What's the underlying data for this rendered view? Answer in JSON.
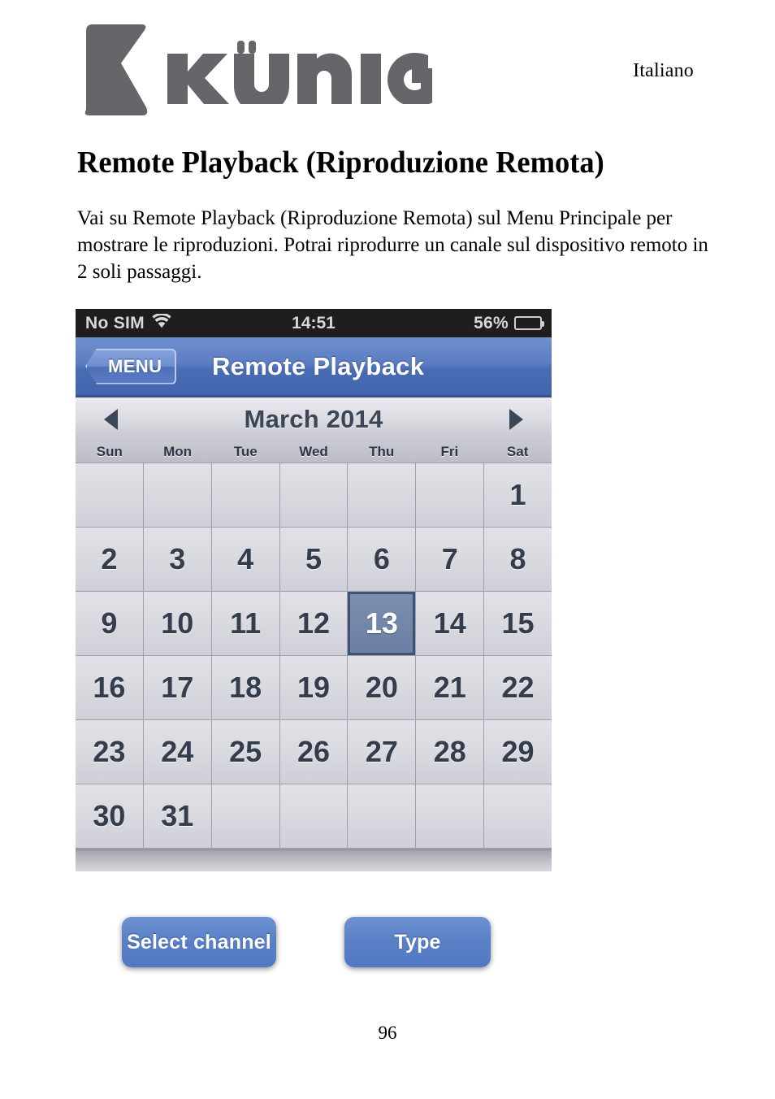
{
  "header": {
    "brand_name": "KÖNIG",
    "logo_icon": "konig-k-logo",
    "language": "Italiano"
  },
  "document": {
    "title": "Remote Playback (Riproduzione Remota)",
    "paragraph": "Vai su Remote Playback (Riproduzione Remota) sul Menu Principale per mostrare le riproduzioni. Potrai riprodurre un canale sul dispositivo remoto in 2 soli passaggi.",
    "page_number": "96"
  },
  "screenshot": {
    "status_bar": {
      "carrier": "No SIM",
      "wifi_icon": "wifi-icon",
      "time": "14:51",
      "battery_percent": "56%",
      "battery_icon": "battery-icon",
      "battery_level": 56
    },
    "nav_bar": {
      "back_label": "MENU",
      "back_icon": "chevron-left-icon",
      "title": "Remote Playback"
    },
    "calendar": {
      "month_label": "March 2014",
      "prev_icon": "triangle-left-icon",
      "next_icon": "triangle-right-icon",
      "weekdays": [
        "Sun",
        "Mon",
        "Tue",
        "Wed",
        "Thu",
        "Fri",
        "Sat"
      ],
      "leading_blanks": 6,
      "days": [
        1,
        2,
        3,
        4,
        5,
        6,
        7,
        8,
        9,
        10,
        11,
        12,
        13,
        14,
        15,
        16,
        17,
        18,
        19,
        20,
        21,
        22,
        23,
        24,
        25,
        26,
        27,
        28,
        29,
        30,
        31
      ],
      "selected_day": 13,
      "trailing_blanks": 5
    },
    "buttons": {
      "select_channel": "Select channel",
      "type": "Type"
    }
  },
  "colors": {
    "nav_blue": "#5b7dc2",
    "button_blue": "#5a7fc6",
    "selected_day": "#6a7fa2",
    "selected_day_border": "#3e5375",
    "cell_gray": "#d9d9e0",
    "status_bar": "#1f1d1e",
    "logo_gray": "#666569"
  }
}
